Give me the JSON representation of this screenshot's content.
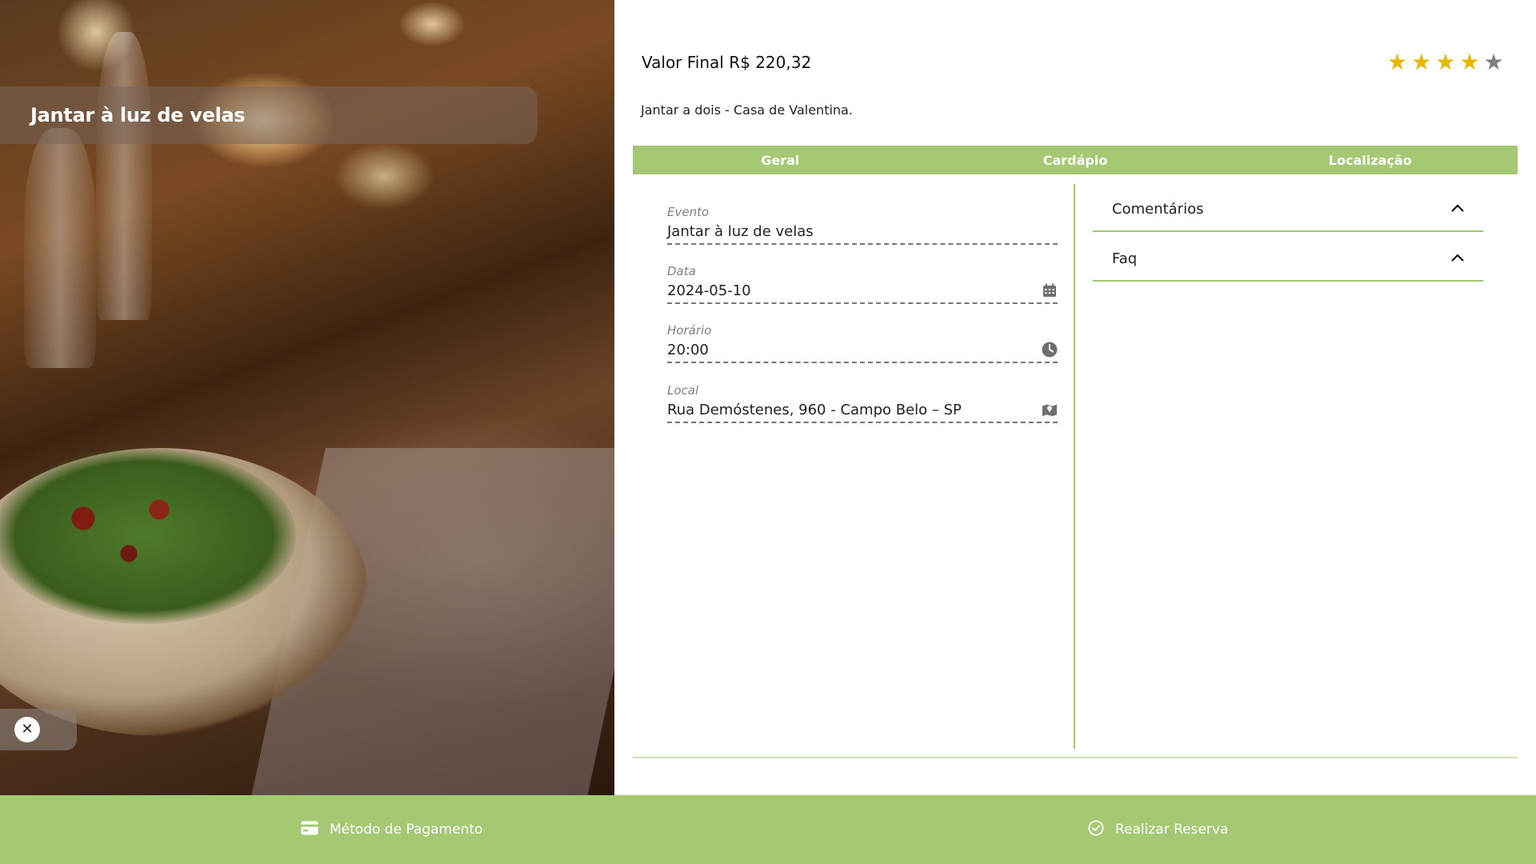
{
  "hero": {
    "title": "Jantar à luz de velas"
  },
  "header": {
    "price": "Valor Final R$ 220,32",
    "rating": {
      "value": 4,
      "max": 5,
      "filled_color": "#e6b800",
      "empty_color": "#808080"
    },
    "description": "Jantar a dois - Casa de Valentina."
  },
  "tabs": [
    "Geral",
    "Cardápio",
    "Localização"
  ],
  "fields": {
    "evento": {
      "label": "Evento",
      "value": "Jantar à luz de velas"
    },
    "data": {
      "label": "Data",
      "value": "2024-05-10",
      "icon": "calendar-icon"
    },
    "horario": {
      "label": "Horário",
      "value": "20:00",
      "icon": "clock-icon"
    },
    "local": {
      "label": "Local",
      "value": "Rua Demóstenes, 960 - Campo Belo – SP",
      "icon": "map-icon"
    }
  },
  "accordions": {
    "comentarios": "Comentários",
    "faq": "Faq"
  },
  "bottom_bar": {
    "payment_label": "Método de Pagamento",
    "reserve_label": "Realizar Reserva"
  },
  "colors": {
    "accent_green": "#a5c872"
  }
}
